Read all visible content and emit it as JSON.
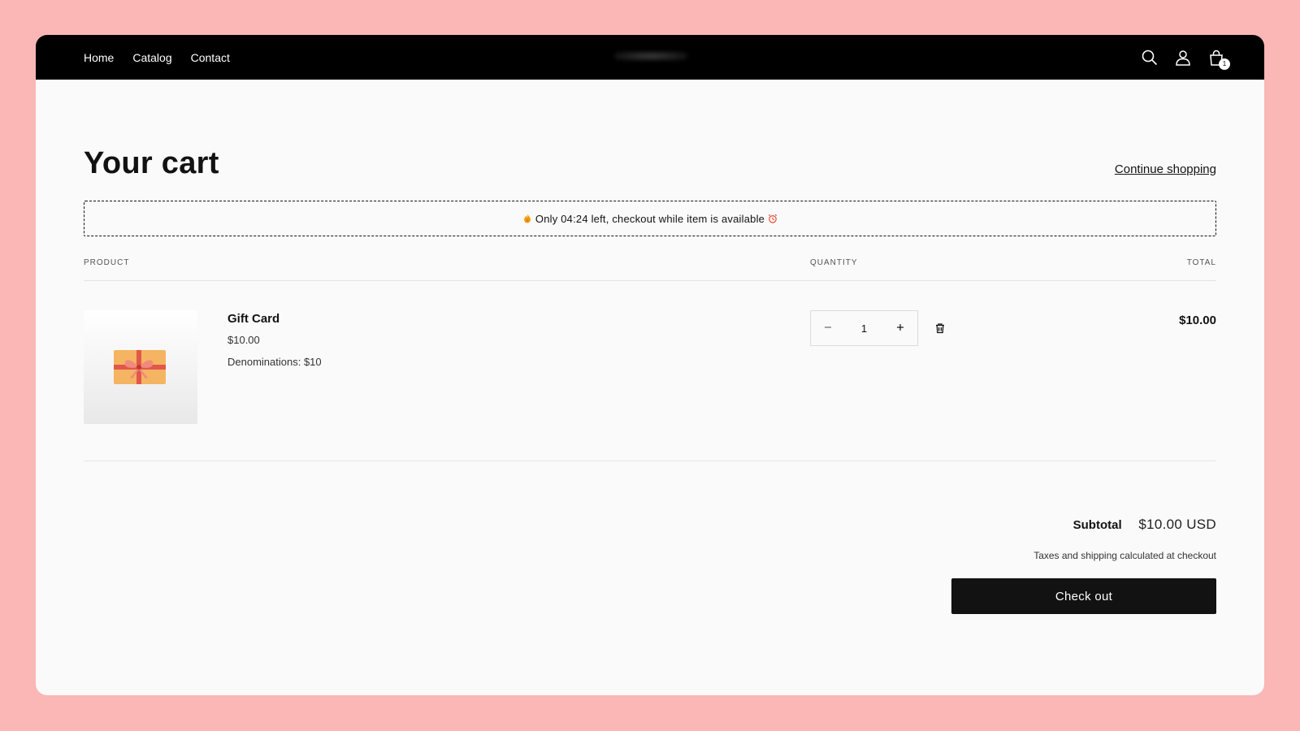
{
  "nav": {
    "links": [
      "Home",
      "Catalog",
      "Contact"
    ],
    "cart_count": "1",
    "icons": [
      "search-icon",
      "account-icon",
      "cart-icon"
    ]
  },
  "page": {
    "title": "Your cart",
    "continue_label": "Continue shopping"
  },
  "timer": {
    "text": "Only 04:24 left, checkout while item is available"
  },
  "table": {
    "headers": {
      "product": "PRODUCT",
      "quantity": "QUANTITY",
      "total": "TOTAL"
    }
  },
  "item": {
    "name": "Gift Card",
    "price": "$10.00",
    "option": "Denominations: $10",
    "quantity": "1",
    "line_total": "$10.00"
  },
  "summary": {
    "subtotal_label": "Subtotal",
    "subtotal_value": "$10.00 USD",
    "tax_note": "Taxes and shipping calculated at checkout",
    "checkout_label": "Check out"
  },
  "colors": {
    "background": "#fbb6b6",
    "navbar": "#000000",
    "button": "#121212",
    "accent_flame": "#f39c12"
  }
}
